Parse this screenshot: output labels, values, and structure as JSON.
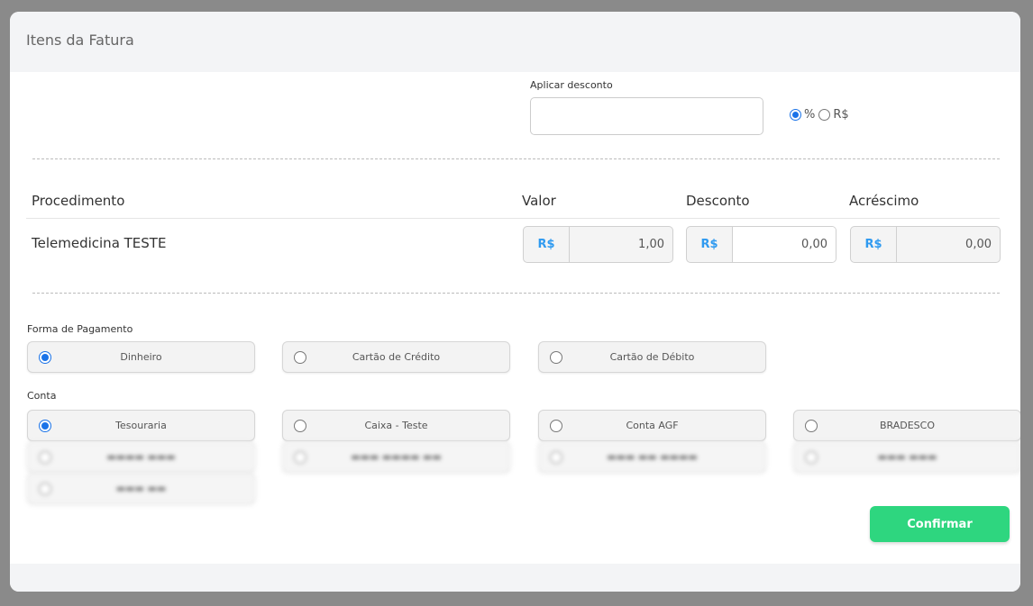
{
  "modal": {
    "title": "Itens da Fatura"
  },
  "discount": {
    "label": "Aplicar desconto",
    "value": "",
    "type_options": [
      {
        "label": "%",
        "checked": true
      },
      {
        "label": "R$",
        "checked": false
      }
    ]
  },
  "table": {
    "headers": {
      "procedure": "Procedimento",
      "value": "Valor",
      "discount": "Desconto",
      "surcharge": "Acréscimo"
    },
    "rows": [
      {
        "procedure": "Telemedicina TESTE",
        "value": {
          "prefix": "R$",
          "amount": "1,00"
        },
        "discount": {
          "prefix": "R$",
          "amount": "0,00"
        },
        "surcharge": {
          "prefix": "R$",
          "amount": "0,00"
        }
      }
    ]
  },
  "payment": {
    "label": "Forma de Pagamento",
    "options": [
      {
        "label": "Dinheiro",
        "checked": true
      },
      {
        "label": "Cartão de Crédito",
        "checked": false
      },
      {
        "label": "Cartão de Débito",
        "checked": false
      }
    ]
  },
  "account": {
    "label": "Conta",
    "options": [
      {
        "label": "Tesouraria",
        "checked": true
      },
      {
        "label": "Caixa - Teste",
        "checked": false
      },
      {
        "label": "Conta AGF",
        "checked": false
      },
      {
        "label": "BRADESCO",
        "checked": false
      }
    ]
  },
  "actions": {
    "confirm": "Confirmar"
  },
  "colors": {
    "primary": "#1a73e8",
    "currency": "#2f9af0",
    "confirm": "#2ed67f"
  }
}
